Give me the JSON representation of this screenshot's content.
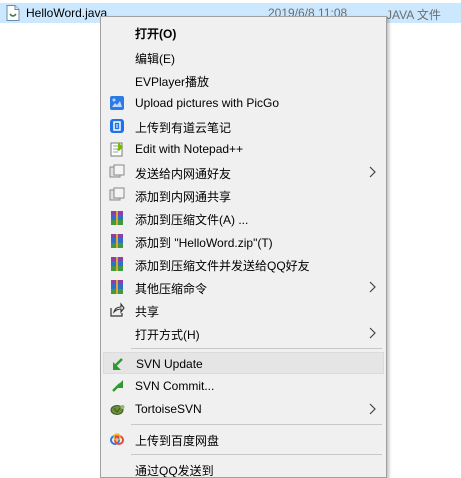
{
  "file": {
    "name": "HelloWord.java",
    "date": "2019/6/8 11:08",
    "type": "JAVA 文件"
  },
  "menu": {
    "items": [
      {
        "label": "打开(O)",
        "icon": ""
      },
      {
        "label": "编辑(E)",
        "icon": ""
      },
      {
        "label": "EVPlayer播放",
        "icon": ""
      },
      {
        "label": "Upload pictures with PicGo",
        "icon": "picgo-icon"
      },
      {
        "label": "上传到有道云笔记",
        "icon": "youdao-note-icon"
      },
      {
        "label": "Edit with Notepad++",
        "icon": "notepad-plus-plus-icon"
      },
      {
        "label": "发送给内网通好友",
        "icon": "neiwangtong-icon",
        "submenu": true
      },
      {
        "label": "添加到内网通共享",
        "icon": "neiwangtong-icon"
      },
      {
        "label": "添加到压缩文件(A) ...",
        "icon": "winrar-icon"
      },
      {
        "label": "添加到 \"HelloWord.zip\"(T)",
        "icon": "winrar-icon"
      },
      {
        "label": "添加到压缩文件并发送给QQ好友",
        "icon": "winrar-icon"
      },
      {
        "label": "其他压缩命令",
        "icon": "winrar-icon",
        "submenu": true
      },
      {
        "label": "共享",
        "icon": "share-icon"
      },
      {
        "label": "打开方式(H)",
        "icon": "",
        "submenu": true
      },
      {
        "label": "SVN Update",
        "icon": "svn-update-icon"
      },
      {
        "label": "SVN Commit...",
        "icon": "svn-commit-icon"
      },
      {
        "label": "TortoiseSVN",
        "icon": "tortoisesvn-icon",
        "submenu": true
      },
      {
        "label": "上传到百度网盘",
        "icon": "baidu-netdisk-icon"
      },
      {
        "label": "通过QQ发送到",
        "icon": ""
      }
    ]
  },
  "colors": {
    "selection": "#cce8ff",
    "menu_bg": "#f0f0f0",
    "hover_bg": "#e5e5e5"
  }
}
